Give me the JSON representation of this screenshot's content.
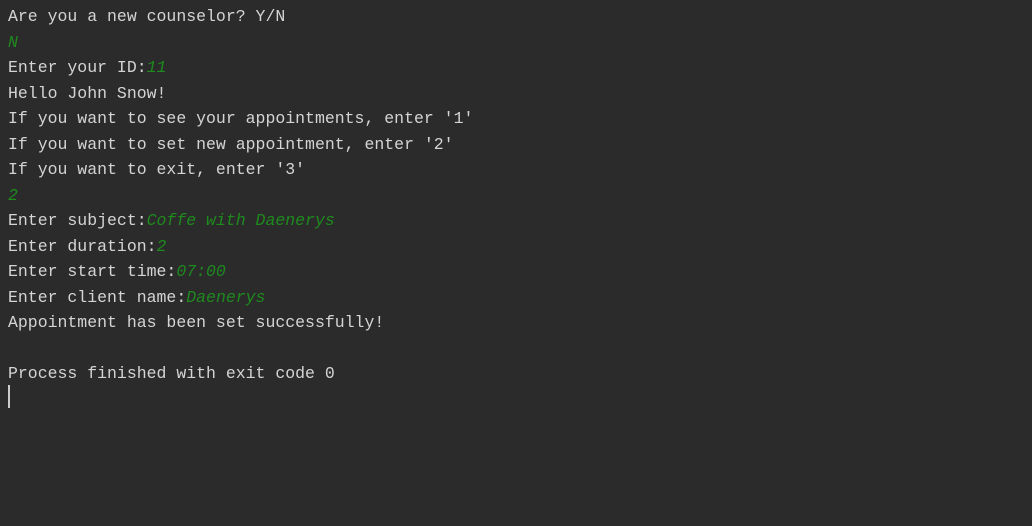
{
  "console": {
    "lines": [
      {
        "prompt": "Are you a new counselor? Y/N",
        "input": ""
      },
      {
        "prompt": "",
        "input": "N"
      },
      {
        "prompt": "Enter your ID:",
        "input": "11"
      },
      {
        "prompt": "Hello John Snow!",
        "input": ""
      },
      {
        "prompt": "If you want to see your appointments, enter '1'",
        "input": ""
      },
      {
        "prompt": "If you want to set new appointment, enter '2'",
        "input": ""
      },
      {
        "prompt": "If you want to exit, enter '3'",
        "input": ""
      },
      {
        "prompt": "",
        "input": "2"
      },
      {
        "prompt": "Enter subject:",
        "input": "Coffe with Daenerys"
      },
      {
        "prompt": "Enter duration:",
        "input": "2"
      },
      {
        "prompt": "Enter start time:",
        "input": "07:00"
      },
      {
        "prompt": "Enter client name:",
        "input": "Daenerys"
      },
      {
        "prompt": "Appointment has been set successfully!",
        "input": ""
      },
      {
        "prompt": "",
        "input": ""
      },
      {
        "prompt": "Process finished with exit code 0",
        "input": ""
      }
    ]
  },
  "colors": {
    "background": "#2b2b2b",
    "output_text": "#d4d4d4",
    "user_input": "#1e8a1e"
  }
}
